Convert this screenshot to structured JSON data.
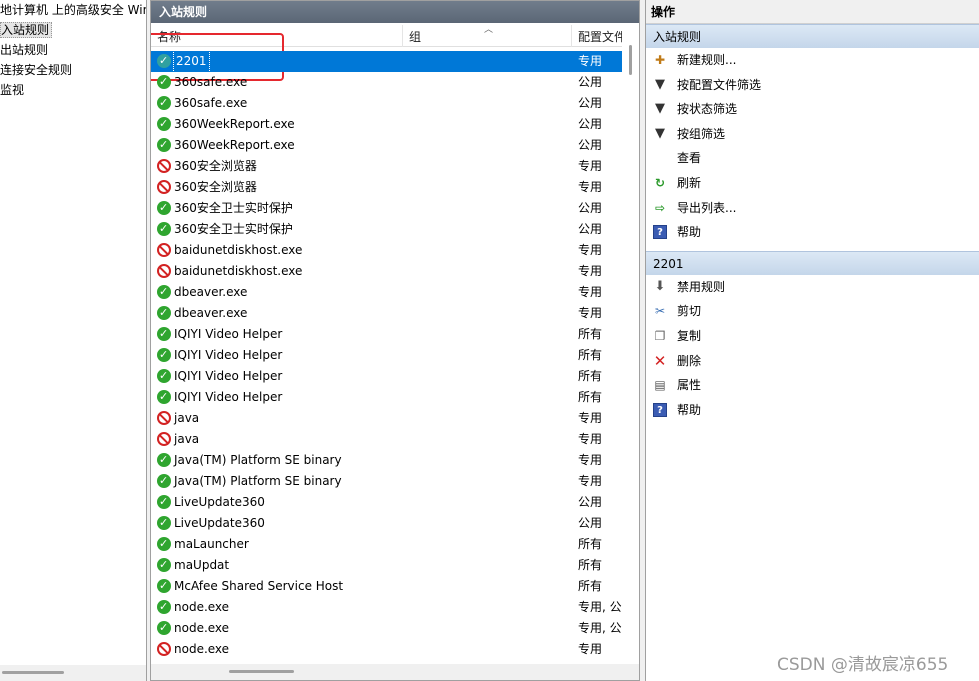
{
  "left_pane": {
    "items": [
      {
        "label": "地计算机 上的高级安全 Wind",
        "selected": false
      },
      {
        "label": "入站规则",
        "selected": true
      },
      {
        "label": "出站规则",
        "selected": false
      },
      {
        "label": "连接安全规则",
        "selected": false
      },
      {
        "label": "监视",
        "selected": false
      }
    ]
  },
  "rules_pane": {
    "title": "入站规则",
    "columns": {
      "name": "名称",
      "group": "组",
      "profile": "配置文件"
    },
    "rows": [
      {
        "name": "2201",
        "profile": "专用",
        "status": "allow",
        "selected": true
      },
      {
        "name": "360safe.exe",
        "profile": "公用",
        "status": "allow"
      },
      {
        "name": "360safe.exe",
        "profile": "公用",
        "status": "allow"
      },
      {
        "name": "360WeekReport.exe",
        "profile": "公用",
        "status": "allow"
      },
      {
        "name": "360WeekReport.exe",
        "profile": "公用",
        "status": "allow"
      },
      {
        "name": "360安全浏览器",
        "profile": "专用",
        "status": "block"
      },
      {
        "name": "360安全浏览器",
        "profile": "专用",
        "status": "block"
      },
      {
        "name": "360安全卫士实时保护",
        "profile": "公用",
        "status": "allow"
      },
      {
        "name": "360安全卫士实时保护",
        "profile": "公用",
        "status": "allow"
      },
      {
        "name": "baidunetdiskhost.exe",
        "profile": "专用",
        "status": "block"
      },
      {
        "name": "baidunetdiskhost.exe",
        "profile": "专用",
        "status": "block"
      },
      {
        "name": "dbeaver.exe",
        "profile": "专用",
        "status": "allow"
      },
      {
        "name": "dbeaver.exe",
        "profile": "专用",
        "status": "allow"
      },
      {
        "name": "IQIYI Video Helper",
        "profile": "所有",
        "status": "allow"
      },
      {
        "name": "IQIYI Video Helper",
        "profile": "所有",
        "status": "allow"
      },
      {
        "name": "IQIYI Video Helper",
        "profile": "所有",
        "status": "allow"
      },
      {
        "name": "IQIYI Video Helper",
        "profile": "所有",
        "status": "allow"
      },
      {
        "name": "java",
        "profile": "专用",
        "status": "block"
      },
      {
        "name": "java",
        "profile": "专用",
        "status": "block"
      },
      {
        "name": "Java(TM) Platform SE binary",
        "profile": "专用",
        "status": "allow"
      },
      {
        "name": "Java(TM) Platform SE binary",
        "profile": "专用",
        "status": "allow"
      },
      {
        "name": "LiveUpdate360",
        "profile": "公用",
        "status": "allow"
      },
      {
        "name": "LiveUpdate360",
        "profile": "公用",
        "status": "allow"
      },
      {
        "name": "maLauncher",
        "profile": "所有",
        "status": "allow"
      },
      {
        "name": "maUpdat",
        "profile": "所有",
        "status": "allow"
      },
      {
        "name": "McAfee Shared Service Host",
        "profile": "所有",
        "status": "allow"
      },
      {
        "name": "node.exe",
        "profile": "专用, 公",
        "status": "allow"
      },
      {
        "name": "node.exe",
        "profile": "专用, 公",
        "status": "allow"
      },
      {
        "name": "node.exe",
        "profile": "专用",
        "status": "block"
      }
    ]
  },
  "actions_pane": {
    "title": "操作",
    "sections": [
      {
        "heading": "入站规则",
        "items": [
          {
            "label": "新建规则...",
            "icon": "new-rule-icon"
          },
          {
            "label": "按配置文件筛选",
            "icon": "filter-icon"
          },
          {
            "label": "按状态筛选",
            "icon": "filter-icon"
          },
          {
            "label": "按组筛选",
            "icon": "filter-icon"
          },
          {
            "label": "查看",
            "icon": ""
          },
          {
            "label": "刷新",
            "icon": "refresh-icon"
          },
          {
            "label": "导出列表...",
            "icon": "export-icon"
          },
          {
            "label": "帮助",
            "icon": "help-icon"
          }
        ]
      },
      {
        "heading": "2201",
        "items": [
          {
            "label": "禁用规则",
            "icon": "disable-icon"
          },
          {
            "label": "剪切",
            "icon": "cut-icon"
          },
          {
            "label": "复制",
            "icon": "copy-icon"
          },
          {
            "label": "删除",
            "icon": "delete-icon"
          },
          {
            "label": "属性",
            "icon": "properties-icon"
          },
          {
            "label": "帮助",
            "icon": "help-icon"
          }
        ]
      }
    ]
  },
  "watermark": "CSDN @清故宸凉655",
  "colors": {
    "selection": "#0078d7",
    "allow": "#2fa52f",
    "block": "#d32222",
    "highlight_box": "#e5282e",
    "section_head": "#c4d6ea"
  }
}
